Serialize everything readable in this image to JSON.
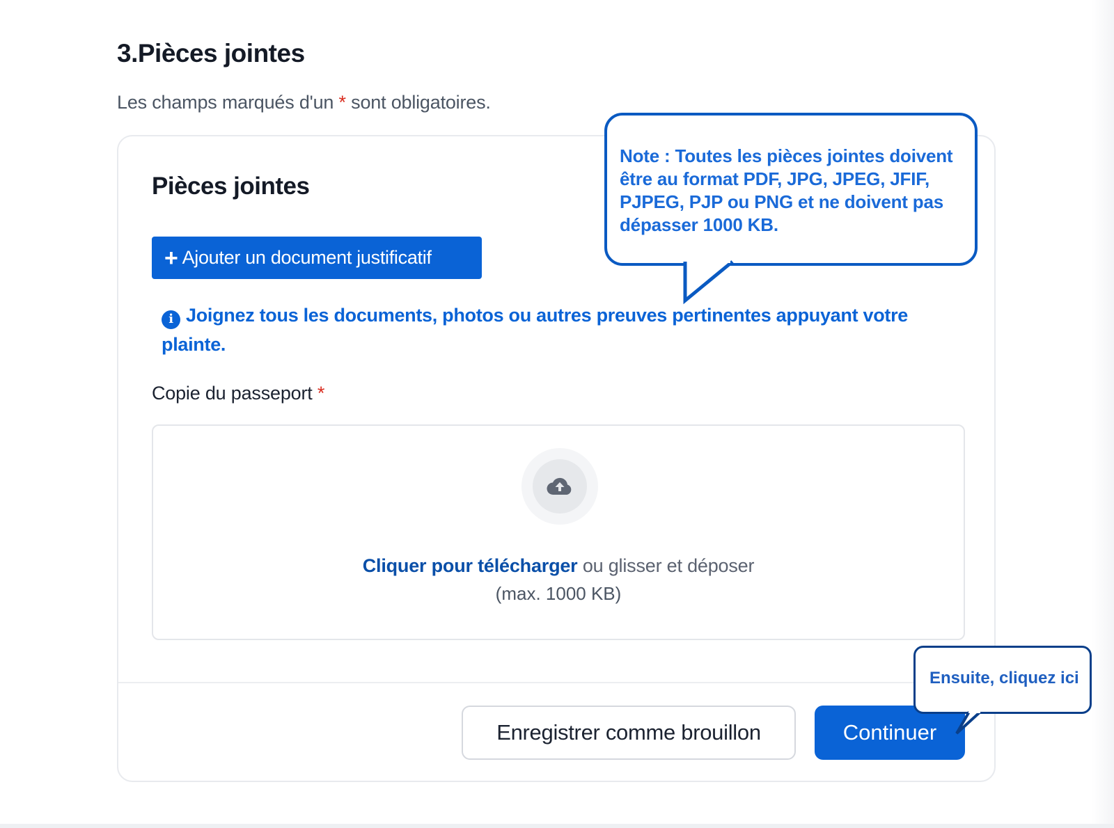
{
  "step": {
    "title": "3.Pièces jointes"
  },
  "required_note": {
    "prefix": "Les champs marqués d'un",
    "star": "*",
    "suffix": "sont obligatoires."
  },
  "card": {
    "title": "Pièces jointes",
    "add_button": {
      "icon": "+",
      "label": "Ajouter un document justificatif"
    },
    "info": {
      "icon": "i",
      "text": "Joignez tous les documents, photos ou autres preuves pertinentes appuyant votre plainte."
    },
    "passport_field": {
      "label": "Copie du passeport",
      "required_star": "*",
      "upload_icon": "cloud-upload-icon",
      "upload_link": "Cliquer pour télécharger",
      "upload_rest": "ou glisser et déposer",
      "upload_limit": "(max. 1000 KB)"
    },
    "actions": {
      "draft_label": "Enregistrer comme brouillon",
      "continue_label": "Continuer"
    }
  },
  "annotations": {
    "note": "Note : Toutes les pièces jointes doivent être au format PDF, JPG, JPEG, JFIF, PJPEG, PJP ou PNG et ne doivent pas dépasser 1000 KB.",
    "next_step": "Ensuite, cliquez ici"
  },
  "colors": {
    "primary": "#0a63d6",
    "link": "#0a4fa8",
    "required": "#d92d20",
    "callout_border": "#0a5ac2"
  }
}
